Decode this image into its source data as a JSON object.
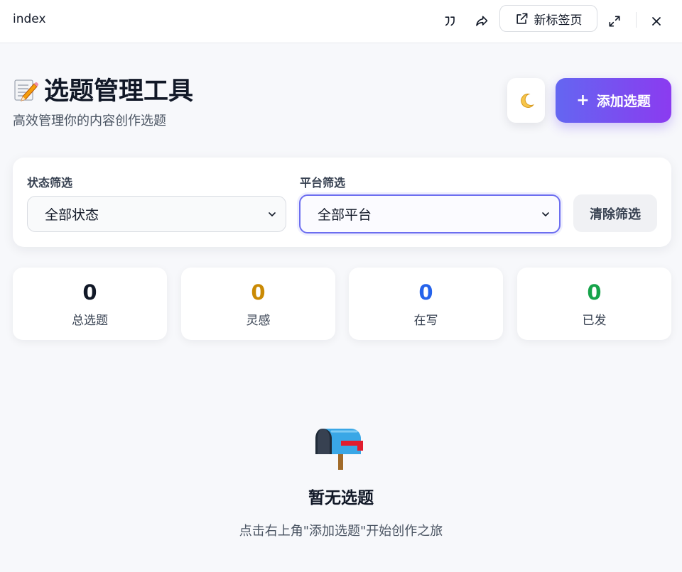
{
  "window": {
    "title": "index",
    "new_tab_label": "新标签页"
  },
  "header": {
    "title": "选题管理工具",
    "subtitle": "高效管理你的内容创作选题",
    "add_button_label": "添加选题",
    "add_button_icon": "+"
  },
  "filters": {
    "status_label": "状态筛选",
    "status_value": "全部状态",
    "platform_label": "平台筛选",
    "platform_value": "全部平台",
    "clear_label": "清除筛选"
  },
  "stats": [
    {
      "value": "0",
      "label": "总选题",
      "color": "#111827"
    },
    {
      "value": "0",
      "label": "灵感",
      "color": "#ca8a04"
    },
    {
      "value": "0",
      "label": "在写",
      "color": "#2563eb"
    },
    {
      "value": "0",
      "label": "已发",
      "color": "#16a34a"
    }
  ],
  "empty": {
    "title": "暂无选题",
    "hint": "点击右上角\"添加选题\"开始创作之旅"
  },
  "colors": {
    "accent_start": "#6466f1",
    "accent_end": "#8b3bf0",
    "focus_border": "#6c6ef0"
  },
  "icons": {
    "title_icon": "memo-icon",
    "theme_toggle": "moon-icon",
    "empty_icon": "mailbox-icon"
  }
}
